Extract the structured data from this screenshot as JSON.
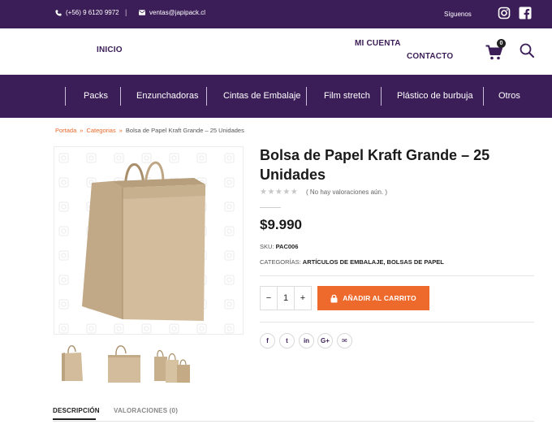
{
  "topbar": {
    "phone": "(+56) 9 6120 9972",
    "email": "ventas@japipack.cl",
    "separator": "|",
    "follow_label": "Síguenos",
    "icons": [
      "phone-icon",
      "envelope-icon",
      "instagram-icon",
      "facebook-icon"
    ]
  },
  "header": {
    "nav": [
      "INICIO",
      "MI CUENTA",
      "CONTACTO"
    ],
    "cart_count": "0",
    "icons": [
      "cart-icon",
      "search-icon"
    ]
  },
  "categories": [
    "Packs",
    "Enzunchadoras",
    "Cintas de Embalaje",
    "Film stretch",
    "Plástico de burbuja",
    "Otros"
  ],
  "breadcrumb": {
    "items": [
      "Portada",
      "Categorias",
      "Bolsa de Papel Kraft Grande – 25 Unidades"
    ],
    "separator": "»"
  },
  "product": {
    "title": "Bolsa de Papel Kraft Grande – 25 Unidades",
    "stars": "★★★★★",
    "rating_text": "( No hay valoraciones aún. )",
    "price": "$9.990",
    "sku_label": "SKU:",
    "sku": "PAC006",
    "categories_label": "CATEGORÍAS:",
    "categories": "ARTÍCULOS DE EMBALAJE, BOLSAS DE PAPEL",
    "quantity": "1",
    "minus": "−",
    "plus": "+",
    "add_to_cart": "AÑADIR AL CARRITO",
    "share_icons": [
      "facebook-icon",
      "twitter-icon",
      "linkedin-icon",
      "googleplus-icon",
      "email-icon"
    ],
    "share_glyphs": [
      "f",
      "t",
      "in",
      "G+",
      "✉"
    ]
  },
  "tabs": [
    "DESCRIPCIÓN",
    "VALORACIONES (0)"
  ],
  "colors": {
    "brand_purple": "#3b1d57",
    "accent_orange": "#ee6a2c",
    "kraft": "#c9b08c"
  }
}
